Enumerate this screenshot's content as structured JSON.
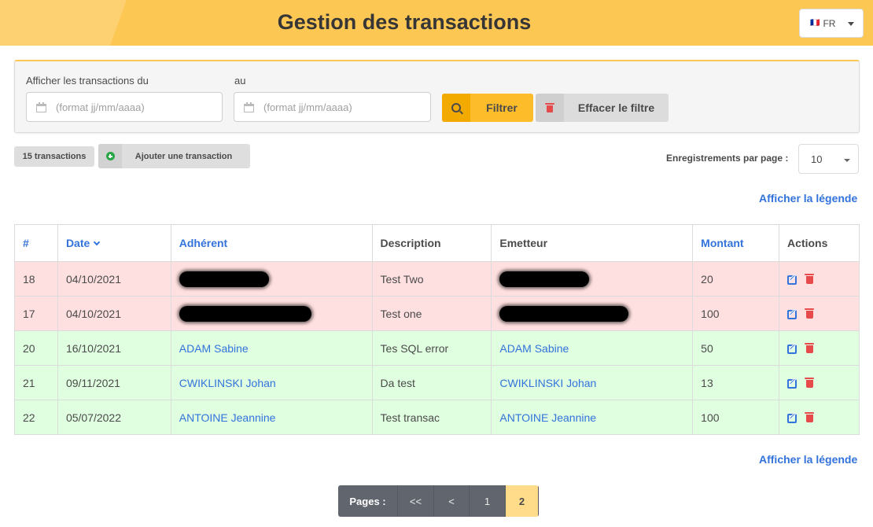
{
  "header": {
    "title": "Gestion des transactions",
    "lang_flag": "🇫🇷",
    "lang_code": "FR"
  },
  "filter": {
    "from_label": "Afficher les transactions du",
    "to_label": "au",
    "from_placeholder": "(format jj/mm/aaaa)",
    "to_placeholder": "(format jj/mm/aaaa)",
    "filter_button": "Filtrer",
    "clear_button": "Effacer le filtre"
  },
  "toolbar": {
    "count_label": "15 transactions",
    "add_button": "Ajouter une transaction",
    "per_page_label": "Enregistrements par page :",
    "per_page_value": "10",
    "legend_link": "Afficher la légende"
  },
  "table": {
    "columns": {
      "id": "#",
      "date": "Date",
      "member": "Adhérent",
      "description": "Description",
      "issuer": "Emetteur",
      "amount": "Montant",
      "actions": "Actions"
    },
    "rows": [
      {
        "id": "18",
        "date": "04/10/2021",
        "member": "",
        "description": "Test Two",
        "issuer": "",
        "amount": "20",
        "status": "error"
      },
      {
        "id": "17",
        "date": "04/10/2021",
        "member": "",
        "description": "Test one",
        "issuer": "",
        "amount": "100",
        "status": "error"
      },
      {
        "id": "20",
        "date": "16/10/2021",
        "member": "ADAM Sabine",
        "description": "Tes SQL error",
        "issuer": "ADAM Sabine",
        "amount": "50",
        "status": "ok"
      },
      {
        "id": "21",
        "date": "09/11/2021",
        "member": "CWIKLINSKI Johan",
        "description": "Da test",
        "issuer": "CWIKLINSKI Johan",
        "amount": "13",
        "status": "ok"
      },
      {
        "id": "22",
        "date": "05/07/2022",
        "member": "ANTOINE Jeannine",
        "description": "Test transac",
        "issuer": "ANTOINE Jeannine",
        "amount": "100",
        "status": "ok"
      }
    ]
  },
  "pagination": {
    "label": "Pages :",
    "first": "<<",
    "prev": "<",
    "pages": [
      "1",
      "2"
    ],
    "current": "2"
  },
  "colors": {
    "accent": "#fdc754",
    "link": "#3273dc",
    "error_row": "#ffe0e0",
    "ok_row": "#e0ffe0",
    "danger": "#e64a4a",
    "success": "#29a745"
  },
  "icons": [
    "calendar-icon",
    "search-icon",
    "trash-icon",
    "plus-circle-icon",
    "edit-icon",
    "delete-icon",
    "sort-down-icon",
    "chevron-down-icon",
    "flag-icon"
  ]
}
